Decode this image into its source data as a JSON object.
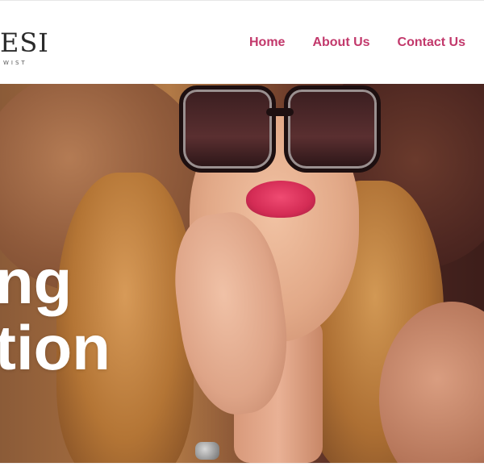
{
  "header": {
    "logo_text": "ESI",
    "logo_tagline": "WIST",
    "nav": [
      {
        "label": "Home"
      },
      {
        "label": "About Us"
      },
      {
        "label": "Contact Us"
      }
    ]
  },
  "hero": {
    "title_line_1": "ng",
    "title_line_2": "tion"
  },
  "colors": {
    "nav_accent": "#c2386b",
    "hero_text": "#ffffff",
    "header_bg": "#ffffff"
  }
}
